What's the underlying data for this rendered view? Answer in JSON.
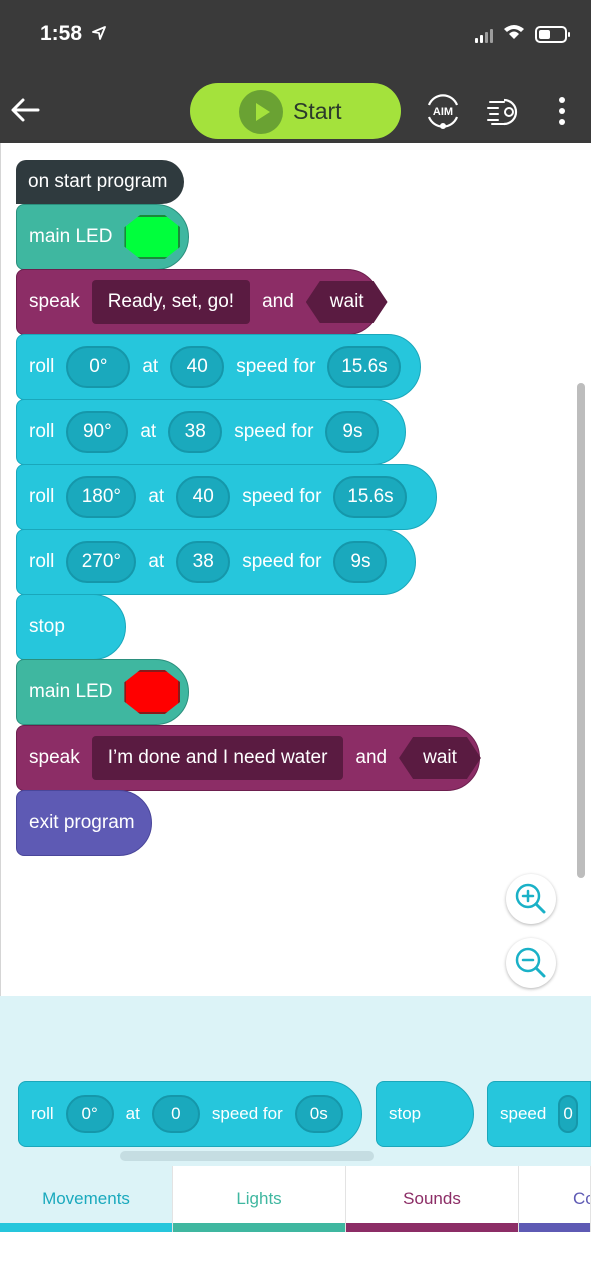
{
  "status_bar": {
    "time": "1:58"
  },
  "toolbar": {
    "start_label": "Start",
    "aim_label": "AIM"
  },
  "program": {
    "on_start": "on start program",
    "led1": {
      "label": "main LED",
      "color": "#00ff3c"
    },
    "speak1": {
      "label": "speak",
      "text": "Ready, set, go!",
      "and": "and",
      "wait": "wait"
    },
    "rolls": [
      {
        "label": "roll",
        "heading": "0°",
        "at": "at",
        "speed": "40",
        "speed_for": "speed for",
        "duration": "15.6s"
      },
      {
        "label": "roll",
        "heading": "90°",
        "at": "at",
        "speed": "38",
        "speed_for": "speed for",
        "duration": "9s"
      },
      {
        "label": "roll",
        "heading": "180°",
        "at": "at",
        "speed": "40",
        "speed_for": "speed for",
        "duration": "15.6s"
      },
      {
        "label": "roll",
        "heading": "270°",
        "at": "at",
        "speed": "38",
        "speed_for": "speed for",
        "duration": "9s"
      }
    ],
    "stop": "stop",
    "led2": {
      "label": "main LED",
      "color": "#ff0000"
    },
    "speak2": {
      "label": "speak",
      "text": "I’m done and I need water",
      "and": "and",
      "wait": "wait"
    },
    "exit": "exit program"
  },
  "palette": {
    "roll": {
      "label": "roll",
      "heading": "0°",
      "at": "at",
      "speed": "0",
      "speed_for": "speed for",
      "duration": "0s"
    },
    "stop": "stop",
    "speed": {
      "label": "speed",
      "value": "0"
    }
  },
  "tabs": [
    {
      "label": "Movements",
      "color": "#26c6dc"
    },
    {
      "label": "Lights",
      "color": "#3fb7a0"
    },
    {
      "label": "Sounds",
      "color": "#8c2d66"
    },
    {
      "label": "Co",
      "color": "#5e5ab4"
    }
  ],
  "colors": {
    "movement": "#26c6dc",
    "lights": "#3fb7a0",
    "sounds": "#8c2d66",
    "control": "#5e5ab4",
    "start": "#a4e23c"
  },
  "icons": [
    "back-arrow-icon",
    "play-icon",
    "aim-icon",
    "drive-icon",
    "more-vertical-icon",
    "zoom-in-icon",
    "zoom-out-icon"
  ]
}
